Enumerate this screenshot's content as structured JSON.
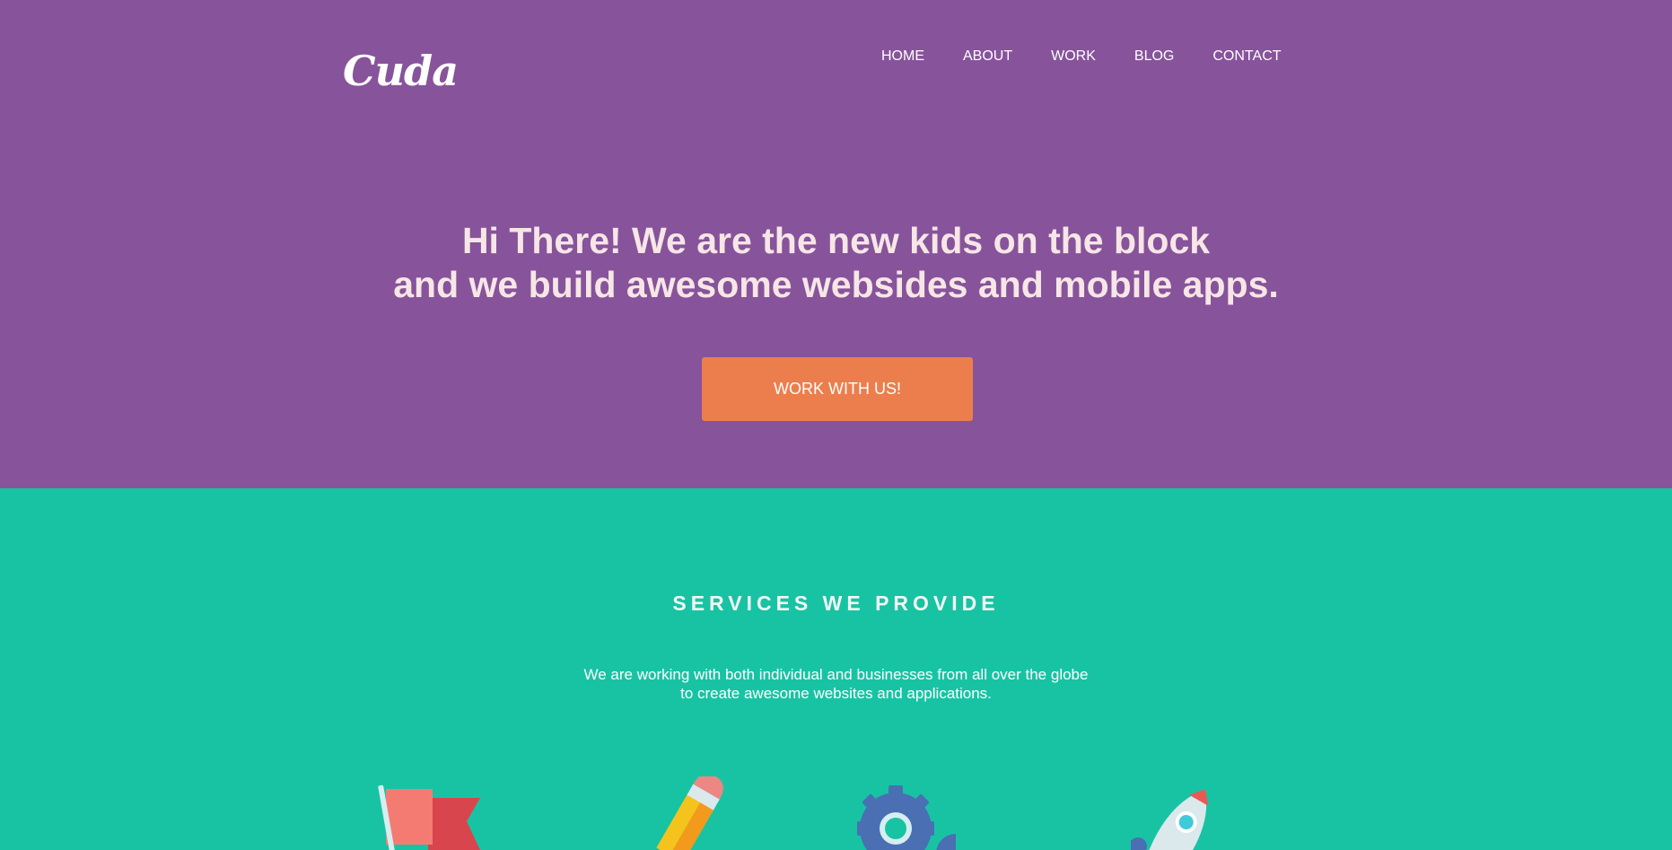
{
  "brand": {
    "logo": "Cuda"
  },
  "nav": {
    "items": [
      "HOME",
      "ABOUT",
      "WORK",
      "BLOG",
      "CONTACT"
    ]
  },
  "hero": {
    "headline_line1": "Hi There! We are the new kids on the block",
    "headline_line2": "and we build awesome websides and mobile apps.",
    "cta_label": "WORK WITH US!"
  },
  "services": {
    "title": "SERVICES WE PROVIDE",
    "desc_line1": "We are working with both individual and businesses from all over the globe",
    "desc_line2": "to create awesome websites and applications.",
    "icons": [
      "flag-icon",
      "pencil-icon",
      "gear-icon",
      "rocket-icon"
    ]
  },
  "colors": {
    "hero_bg": "#87539b",
    "services_bg": "#18c3a4",
    "cta_bg": "#ec7e4d",
    "headline_text": "#f6e6e6"
  }
}
